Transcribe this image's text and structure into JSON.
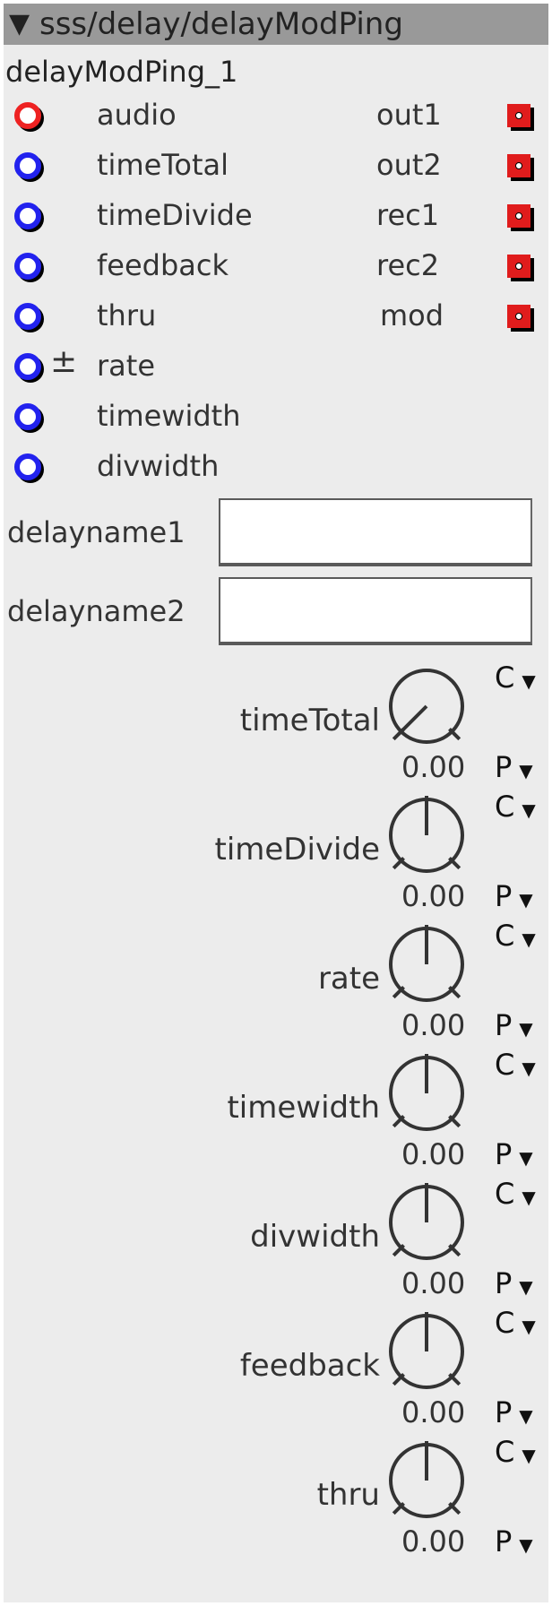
{
  "header": {
    "collapse_glyph": "▼",
    "title": "sss/delay/delayModPing"
  },
  "instance_name": "delayModPing_1",
  "inputs": [
    {
      "label": "audio",
      "type": "audio",
      "modifier": ""
    },
    {
      "label": "timeTotal",
      "type": "control",
      "modifier": ""
    },
    {
      "label": "timeDivide",
      "type": "control",
      "modifier": ""
    },
    {
      "label": "feedback",
      "type": "control",
      "modifier": ""
    },
    {
      "label": "thru",
      "type": "control",
      "modifier": ""
    },
    {
      "label": "rate",
      "type": "control",
      "modifier": "±"
    },
    {
      "label": "timewidth",
      "type": "control",
      "modifier": ""
    },
    {
      "label": "divwidth",
      "type": "control",
      "modifier": ""
    }
  ],
  "outputs": [
    {
      "label": "out1"
    },
    {
      "label": "out2"
    },
    {
      "label": "rec1"
    },
    {
      "label": "rec2"
    },
    {
      "label": "mod"
    }
  ],
  "string_params": [
    {
      "label": "delayname1",
      "value": ""
    },
    {
      "label": "delayname2",
      "value": ""
    }
  ],
  "knobs": [
    {
      "label": "timeTotal",
      "value": "0.00",
      "position": 0.0,
      "c_label": "C",
      "p_label": "P"
    },
    {
      "label": "timeDivide",
      "value": "0.00",
      "position": 0.5,
      "c_label": "C",
      "p_label": "P"
    },
    {
      "label": "rate",
      "value": "0.00",
      "position": 0.5,
      "c_label": "C",
      "p_label": "P"
    },
    {
      "label": "timewidth",
      "value": "0.00",
      "position": 0.5,
      "c_label": "C",
      "p_label": "P"
    },
    {
      "label": "divwidth",
      "value": "0.00",
      "position": 0.5,
      "c_label": "C",
      "p_label": "P"
    },
    {
      "label": "feedback",
      "value": "0.00",
      "position": 0.5,
      "c_label": "C",
      "p_label": "P"
    },
    {
      "label": "thru",
      "value": "0.00",
      "position": 0.5,
      "c_label": "C",
      "p_label": "P"
    }
  ],
  "dropdown_arrow": "▼",
  "colors": {
    "panel_bg": "#ececec",
    "titlebar_bg": "#999999",
    "audio_port": "#ee2222",
    "control_port": "#2222ee",
    "output_port": "#e01c1c"
  }
}
